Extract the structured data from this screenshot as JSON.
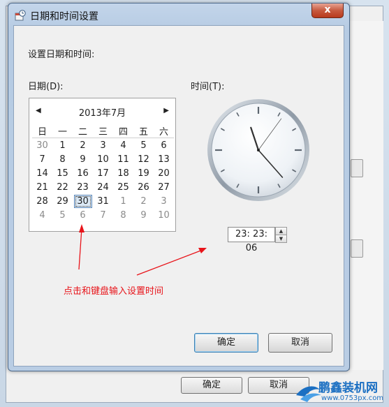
{
  "dialog": {
    "title": "日期和时间设置",
    "close_label": "x",
    "heading": "设置日期和时间:",
    "date_label": "日期(D):",
    "time_label": "时间(T):",
    "ok_label": "确定",
    "cancel_label": "取消"
  },
  "calendar": {
    "month_title": "2013年7月",
    "prev_glyph": "◀",
    "next_glyph": "▶",
    "weekdays": [
      "日",
      "一",
      "二",
      "三",
      "四",
      "五",
      "六"
    ],
    "weeks": [
      [
        {
          "d": "30",
          "other": true
        },
        {
          "d": "1"
        },
        {
          "d": "2"
        },
        {
          "d": "3"
        },
        {
          "d": "4"
        },
        {
          "d": "5"
        },
        {
          "d": "6"
        }
      ],
      [
        {
          "d": "7"
        },
        {
          "d": "8"
        },
        {
          "d": "9"
        },
        {
          "d": "10"
        },
        {
          "d": "11"
        },
        {
          "d": "12"
        },
        {
          "d": "13"
        }
      ],
      [
        {
          "d": "14"
        },
        {
          "d": "15"
        },
        {
          "d": "16"
        },
        {
          "d": "17"
        },
        {
          "d": "18"
        },
        {
          "d": "19"
        },
        {
          "d": "20"
        }
      ],
      [
        {
          "d": "21"
        },
        {
          "d": "22"
        },
        {
          "d": "23"
        },
        {
          "d": "24"
        },
        {
          "d": "25"
        },
        {
          "d": "26"
        },
        {
          "d": "27"
        }
      ],
      [
        {
          "d": "28"
        },
        {
          "d": "29"
        },
        {
          "d": "30",
          "selected": true
        },
        {
          "d": "31"
        },
        {
          "d": "1",
          "other": true
        },
        {
          "d": "2",
          "other": true
        },
        {
          "d": "3",
          "other": true
        }
      ],
      [
        {
          "d": "4",
          "other": true
        },
        {
          "d": "5",
          "other": true
        },
        {
          "d": "6",
          "other": true
        },
        {
          "d": "7",
          "other": true
        },
        {
          "d": "8",
          "other": true
        },
        {
          "d": "9",
          "other": true
        },
        {
          "d": "10",
          "other": true
        }
      ]
    ]
  },
  "clock": {
    "hours": 23,
    "minutes": 23,
    "seconds": 6
  },
  "time_field": {
    "value": "23: 23: 06",
    "up_glyph": "▲",
    "down_glyph": "▼"
  },
  "annotation": {
    "text": "点击和键盘输入设置时间",
    "color": "#e8141a"
  },
  "background_window": {
    "ok_label": "确定",
    "cancel_label": "取消"
  },
  "watermark": {
    "main": "鹏鑫装机网",
    "sub": "www.0753px.com"
  },
  "colors": {
    "accent": "#3c7fb1",
    "annotation": "#e8141a",
    "watermark": "#1b6fc2"
  }
}
